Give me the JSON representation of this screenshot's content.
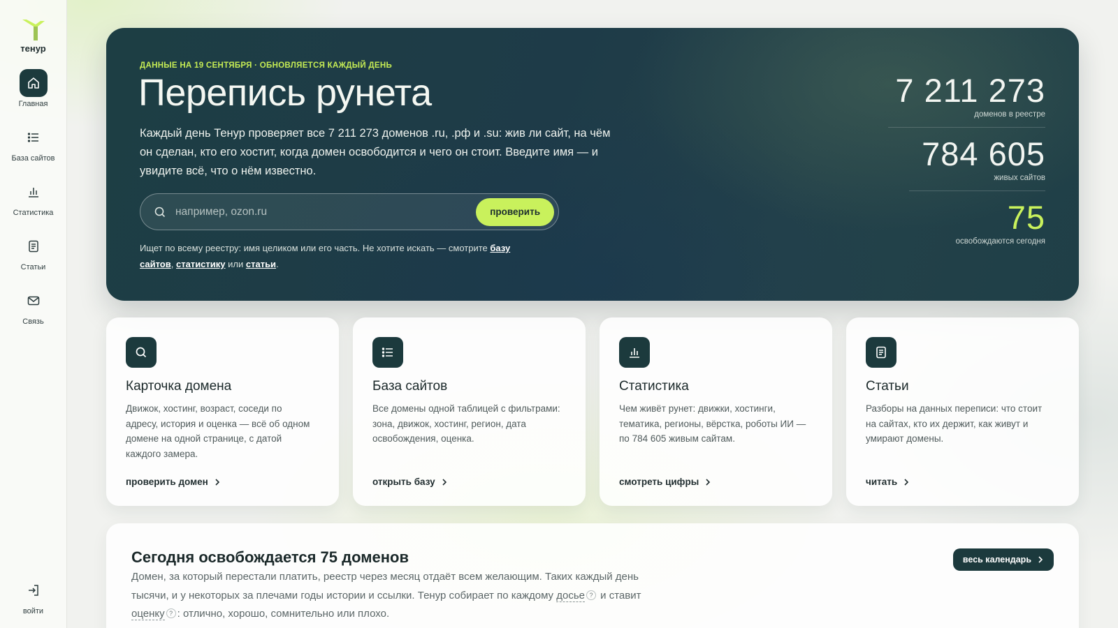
{
  "brand": {
    "name": "тенур",
    "accent": "#c9f15c",
    "dark": "#1c3a3d"
  },
  "sidebar": {
    "items": [
      {
        "label": "Главная",
        "icon": "home-icon",
        "active": true
      },
      {
        "label": "База сайтов",
        "icon": "list-icon"
      },
      {
        "label": "Статистика",
        "icon": "bar-chart-icon"
      },
      {
        "label": "Статьи",
        "icon": "document-icon"
      },
      {
        "label": "Связь",
        "icon": "mail-icon"
      }
    ],
    "login": {
      "label": "войти",
      "icon": "login-icon"
    }
  },
  "hero": {
    "kicker": "ДАННЫЕ НА 19 СЕНТЯБРЯ · ОБНОВЛЯЕТСЯ КАЖДЫЙ ДЕНЬ",
    "title": "Перепись рунета",
    "description": "Каждый день Тенур проверяет все 7 211 273 доменов .ru, .рф и .su: жив ли сайт, на чём он сделан, кто его хостит, когда домен освободится и чего он стоит. Введите имя — и увидите всё, что о нём известно.",
    "search": {
      "placeholder": "например, ozon.ru",
      "value": "",
      "button": "проверить"
    },
    "note_prefix": "Ищет по всему реестру: имя целиком или его часть. Не хотите искать — смотрите",
    "note_link1": "базу сайтов",
    "note_sep1": ",",
    "note_link2": "статистику",
    "note_sep2": "или",
    "note_link3": "статьи",
    "note_end": "."
  },
  "stats": [
    {
      "value": "7 211 273",
      "label": "доменов в реестре"
    },
    {
      "value": "784 605",
      "label": "живых сайтов"
    },
    {
      "value": "75",
      "label": "освобождаются сегодня"
    }
  ],
  "cards": [
    {
      "icon": "search-icon",
      "title": "Карточка домена",
      "description": "Движок, хостинг, возраст, соседи по адресу, история и оценка — всё об одном домене на одной странице, с датой каждого замера.",
      "link": "проверить домен"
    },
    {
      "icon": "list-icon",
      "title": "База сайтов",
      "description": "Все домены одной таблицей с фильтрами: зона, движок, хостинг, регион, дата освобождения, оценка.",
      "link": "открыть базу"
    },
    {
      "icon": "bar-chart-icon",
      "title": "Статистика",
      "description": "Чем живёт рунет: движки, хостинги, тематика, регионы, вёрстка, роботы ИИ — по 784 605 живым сайтам.",
      "link": "смотреть цифры"
    },
    {
      "icon": "document-icon",
      "title": "Статьи",
      "description": "Разборы на данных переписи: что стоит на сайтах, кто их держит, как живут и умирают домены.",
      "link": "читать"
    }
  ],
  "release": {
    "title": "Сегодня освобождается 75 доменов",
    "desc_part1": "Домен, за который перестали платить, реестр через месяц отдаёт всем желающим. Таких каждый день тысячи, и у некоторых за плечами годы истории и ссылки. Тенур собирает по каждому",
    "term1": "досье",
    "desc_part2": "и ставит",
    "term2": "оценку",
    "desc_part3": ": отлично, хорошо, сомнительно или плохо.",
    "qmark": "?",
    "button": "весь календарь"
  }
}
